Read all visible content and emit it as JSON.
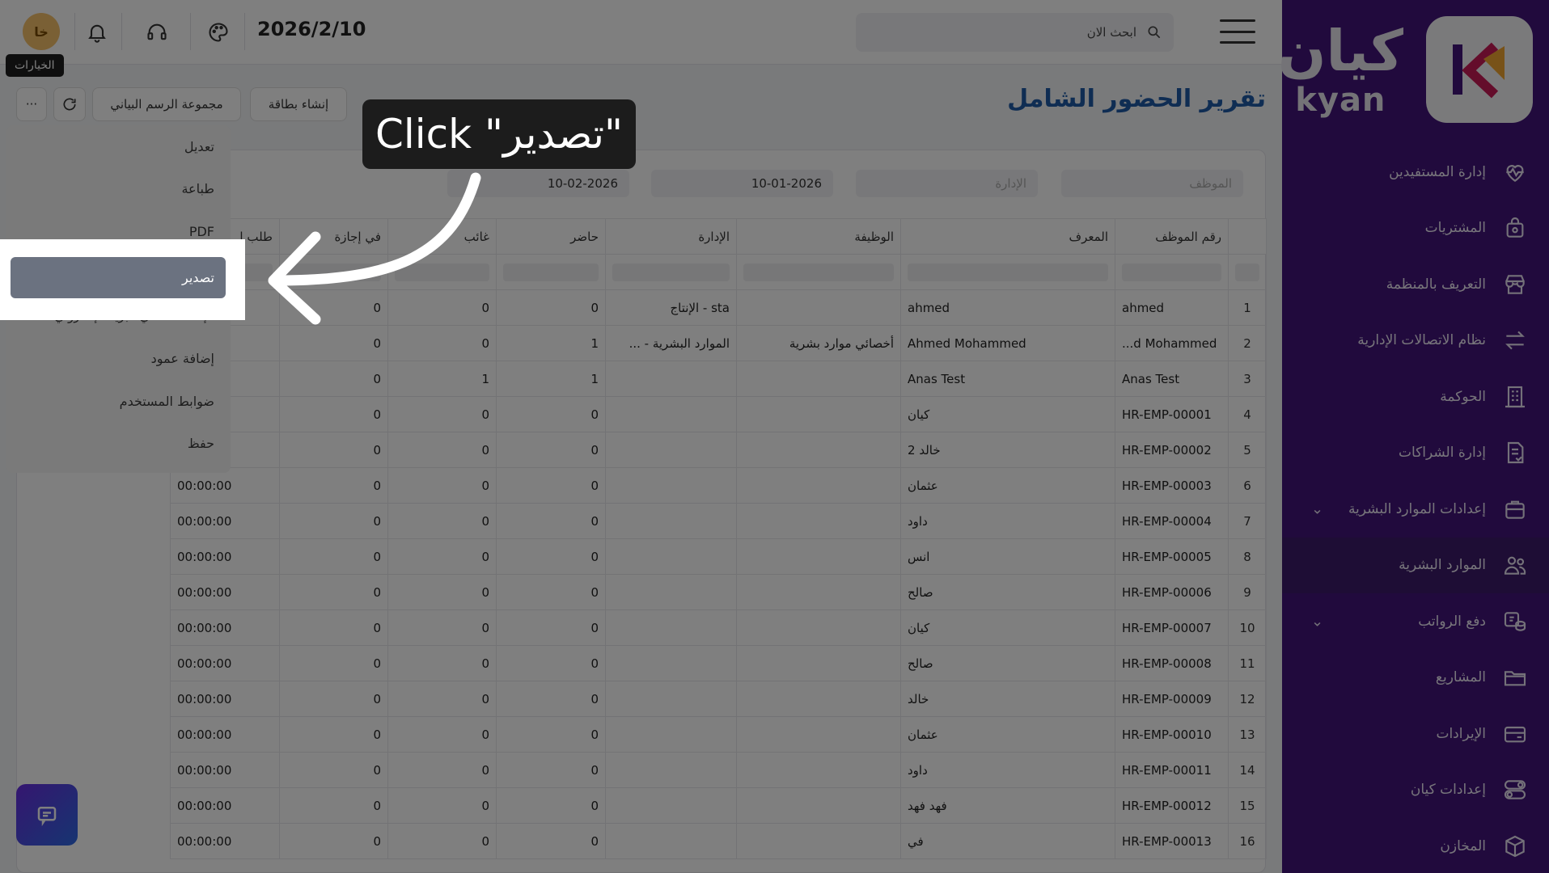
{
  "topbar": {
    "avatar_initials": "خا",
    "date": "2026/2/10",
    "search_placeholder": "ابحث الان"
  },
  "toolbar": {
    "tooltip": "الخيارات",
    "more_label": "···",
    "chart_group_label": "مجموعة الرسم البياني",
    "create_card_label": "إنشاء بطاقة"
  },
  "page": {
    "title": "تقرير الحضور الشامل"
  },
  "filters": {
    "employee_placeholder": "الموظف",
    "department_placeholder": "الإدارة",
    "from_date": "10-01-2026",
    "to_date": "10-02-2026"
  },
  "table": {
    "headers": {
      "emp_id": "رقم الموظف",
      "identifier": "المعرف",
      "job": "الوظيفة",
      "department": "الإدارة",
      "present": "حاضر",
      "absent": "غائب",
      "on_leave": "في إجازة",
      "leave_request": "طلب إ"
    },
    "rows": [
      {
        "n": "1",
        "emp_id": "ahmed",
        "identifier": "ahmed",
        "job": "",
        "department": "sta - الإنتاج",
        "present": "0",
        "absent": "0",
        "on_leave": "0",
        "time": ""
      },
      {
        "n": "2",
        "emp_id": "...d Mohammed",
        "identifier": "Ahmed Mohammed",
        "job": "أخصائي موارد بشرية",
        "department": "الموارد البشرية - ...",
        "present": "1",
        "absent": "0",
        "on_leave": "0",
        "time": ""
      },
      {
        "n": "3",
        "emp_id": "Anas Test",
        "identifier": "Anas Test",
        "job": "",
        "department": "",
        "present": "1",
        "absent": "1",
        "on_leave": "0",
        "time": ""
      },
      {
        "n": "4",
        "emp_id": "HR-EMP-00001",
        "identifier": "كيان",
        "job": "",
        "department": "",
        "present": "0",
        "absent": "0",
        "on_leave": "0",
        "time": ""
      },
      {
        "n": "5",
        "emp_id": "HR-EMP-00002",
        "identifier": "خالد 2",
        "job": "",
        "department": "",
        "present": "0",
        "absent": "0",
        "on_leave": "0",
        "time": ""
      },
      {
        "n": "6",
        "emp_id": "HR-EMP-00003",
        "identifier": "عثمان",
        "job": "",
        "department": "",
        "present": "0",
        "absent": "0",
        "on_leave": "0",
        "time": "00:00:00"
      },
      {
        "n": "7",
        "emp_id": "HR-EMP-00004",
        "identifier": "داود",
        "job": "",
        "department": "",
        "present": "0",
        "absent": "0",
        "on_leave": "0",
        "time": "00:00:00"
      },
      {
        "n": "8",
        "emp_id": "HR-EMP-00005",
        "identifier": "انس",
        "job": "",
        "department": "",
        "present": "0",
        "absent": "0",
        "on_leave": "0",
        "time": "00:00:00"
      },
      {
        "n": "9",
        "emp_id": "HR-EMP-00006",
        "identifier": "صالح",
        "job": "",
        "department": "",
        "present": "0",
        "absent": "0",
        "on_leave": "0",
        "time": "00:00:00"
      },
      {
        "n": "10",
        "emp_id": "HR-EMP-00007",
        "identifier": "كيان",
        "job": "",
        "department": "",
        "present": "0",
        "absent": "0",
        "on_leave": "0",
        "time": "00:00:00"
      },
      {
        "n": "11",
        "emp_id": "HR-EMP-00008",
        "identifier": "صالح",
        "job": "",
        "department": "",
        "present": "0",
        "absent": "0",
        "on_leave": "0",
        "time": "00:00:00"
      },
      {
        "n": "12",
        "emp_id": "HR-EMP-00009",
        "identifier": "خالد",
        "job": "",
        "department": "",
        "present": "0",
        "absent": "0",
        "on_leave": "0",
        "time": "00:00:00"
      },
      {
        "n": "13",
        "emp_id": "HR-EMP-00010",
        "identifier": "عثمان",
        "job": "",
        "department": "",
        "present": "0",
        "absent": "0",
        "on_leave": "0",
        "time": "00:00:00"
      },
      {
        "n": "14",
        "emp_id": "HR-EMP-00011",
        "identifier": "داود",
        "job": "",
        "department": "",
        "present": "0",
        "absent": "0",
        "on_leave": "0",
        "time": "00:00:00"
      },
      {
        "n": "15",
        "emp_id": "HR-EMP-00012",
        "identifier": "فهد فهد",
        "job": "",
        "department": "",
        "present": "0",
        "absent": "0",
        "on_leave": "0",
        "time": "00:00:00"
      },
      {
        "n": "16",
        "emp_id": "HR-EMP-00013",
        "identifier": "في",
        "job": "",
        "department": "",
        "present": "0",
        "absent": "0",
        "on_leave": "0",
        "time": "00:00:00"
      }
    ]
  },
  "dropdown": {
    "items": [
      "تعديل",
      "طباعة",
      "PDF",
      "تصدير",
      "الإعداد التلقائي البريد الإلكتروني",
      "إضافة عمود",
      "ضوابط المستخدم",
      "حفظ"
    ]
  },
  "callout": {
    "text": "Click \"تصدير\""
  },
  "sidebar": {
    "logo_ar": "كيان",
    "logo_en": "kyan",
    "items": [
      {
        "label": "إدارة المستفيدين",
        "icon": "heart-pulse-icon"
      },
      {
        "label": "المشتريات",
        "icon": "shopping-bag-icon"
      },
      {
        "label": "التعريف بالمنظمة",
        "icon": "store-icon"
      },
      {
        "label": "نظام الاتصالات الإدارية",
        "icon": "arrows-exchange-icon"
      },
      {
        "label": "الحوكمة",
        "icon": "building-icon"
      },
      {
        "label": "إدارة الشراكات",
        "icon": "document-icon"
      },
      {
        "label": "إعدادات الموارد البشرية",
        "icon": "briefcase-icon"
      },
      {
        "label": "الموارد البشرية",
        "icon": "users-icon"
      },
      {
        "label": "دفع الرواتب",
        "icon": "coins-icon"
      },
      {
        "label": "المشاريع",
        "icon": "folder-icon"
      },
      {
        "label": "الإيرادات",
        "icon": "card-icon"
      },
      {
        "label": "إعدادات كيان",
        "icon": "toggles-icon"
      },
      {
        "label": "المخازن",
        "icon": "box-icon"
      }
    ]
  },
  "colors": {
    "sidebar_bg": "#43157a",
    "title_blue": "#1f5aa6",
    "export_highlight": "#6b7280"
  }
}
